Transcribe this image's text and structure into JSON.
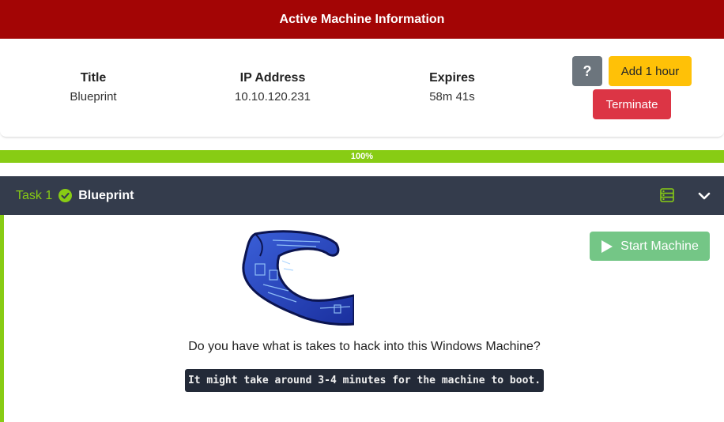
{
  "header": {
    "title": "Active Machine Information"
  },
  "machine": {
    "title_label": "Title",
    "title_value": "Blueprint",
    "ip_label": "IP Address",
    "ip_value": "10.10.120.231",
    "expires_label": "Expires",
    "expires_value": "58m 41s"
  },
  "buttons": {
    "help": "?",
    "add_hour": "Add 1 hour",
    "terminate": "Terminate"
  },
  "progress": {
    "value": 100,
    "label": "100%"
  },
  "task": {
    "number": "Task 1",
    "name": "Blueprint",
    "start_machine": "Start Machine",
    "question": "Do you have what is takes to hack into this Windows Machine?",
    "boot_note": "It might take around 3-4 minutes for the machine to boot."
  },
  "colors": {
    "header": "#a30505",
    "accent_green": "#88cc14",
    "terminate": "#dc3545",
    "add_hour": "#ffc107",
    "task_header": "#343c4c"
  },
  "icons": [
    "question-mark-icon",
    "check-circle-icon",
    "server-list-icon",
    "chevron-down-icon",
    "play-icon",
    "blueprint-image"
  ]
}
